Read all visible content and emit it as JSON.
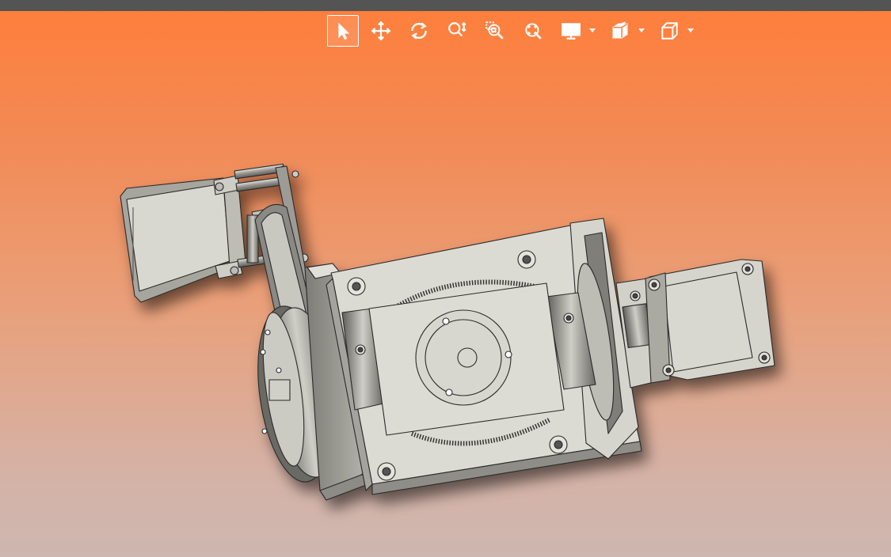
{
  "app": {
    "background_gradient": [
      "#ff7e3a",
      "#cdb7b0"
    ],
    "topbar_color": "#545454"
  },
  "toolbar": {
    "icon_color": "#ffffff",
    "tools": [
      {
        "icon": "select-arrow-icon",
        "selected": true
      },
      {
        "icon": "pan-move-icon",
        "selected": false
      },
      {
        "icon": "rotate-icon",
        "selected": false
      },
      {
        "icon": "zoom-in-out-icon",
        "selected": false
      },
      {
        "icon": "zoom-window-icon",
        "selected": false
      },
      {
        "icon": "zoom-fit-icon",
        "selected": false
      },
      {
        "icon": "display-mode-icon",
        "has_dropdown": true
      },
      {
        "icon": "section-view-icon",
        "has_dropdown": true
      },
      {
        "icon": "view-orientation-cube-icon",
        "has_dropdown": true
      }
    ]
  },
  "model": {
    "description_visible": false,
    "part_color": "#d9d8d0",
    "edge_color": "#2a2a2a",
    "shadow_color": "#6b4a3a"
  }
}
